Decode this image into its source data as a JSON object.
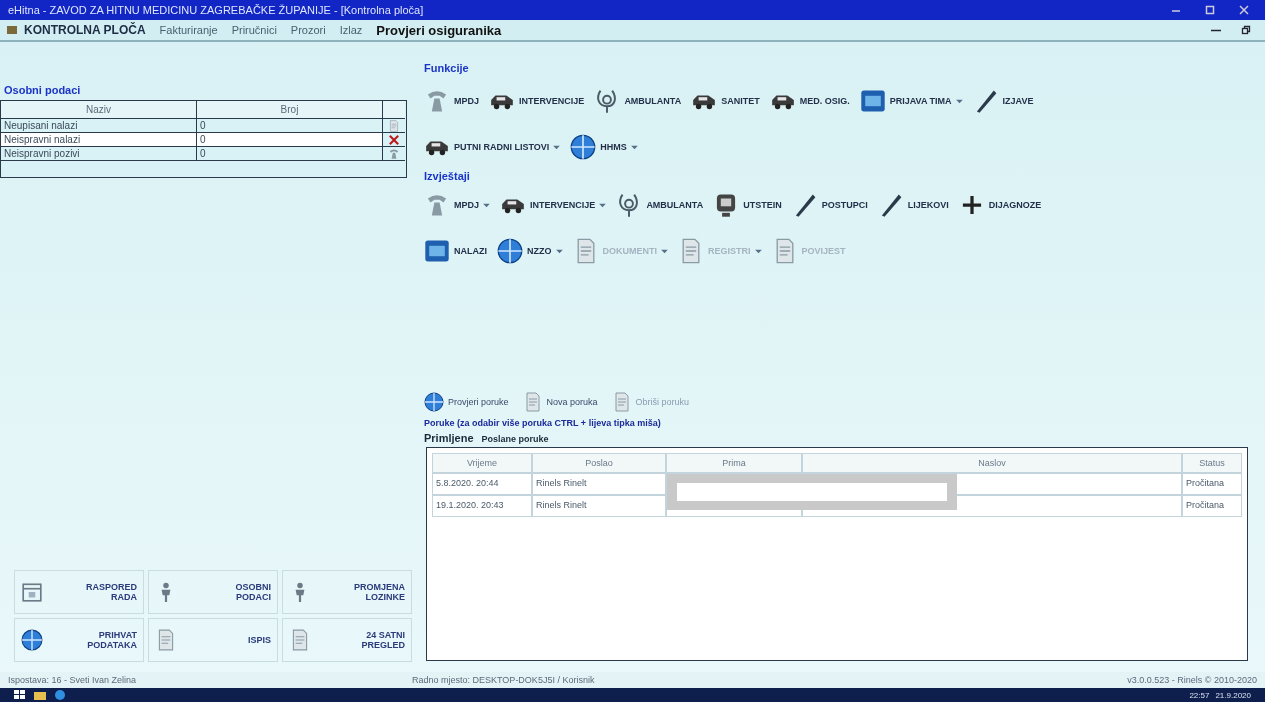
{
  "window": {
    "title": "eHitna - ZAVOD ZA HITNU MEDICINU ZAGREBAČKE ŽUPANIJE - [Kontrolna ploča]"
  },
  "menu": {
    "home": "KONTROLNA PLOČA",
    "items": [
      "Fakturiranje",
      "Priručnici",
      "Prozori",
      "Izlaz"
    ],
    "check": "Provjeri osiguranika"
  },
  "personal": {
    "title": "Osobni podaci",
    "columns": [
      "Naziv",
      "Broj"
    ],
    "rows": [
      {
        "name": "Neupisani nalazi",
        "count": "0",
        "selected": false,
        "kind": "doc"
      },
      {
        "name": "Neispravni nalazi",
        "count": "0",
        "selected": true,
        "kind": "cross"
      },
      {
        "name": "Neispravni pozivi",
        "count": "0",
        "selected": false,
        "kind": "phone"
      }
    ]
  },
  "functions": {
    "title": "Funkcije",
    "rows": [
      [
        {
          "label": "MPDJ",
          "kind": "phone",
          "menu": false,
          "disabled": false
        },
        {
          "label": "INTERVENCIJE",
          "kind": "vehicle",
          "menu": false,
          "disabled": false
        },
        {
          "label": "AMBULANTA",
          "kind": "stethoscope",
          "menu": false,
          "disabled": false
        },
        {
          "label": "SANITET",
          "kind": "vehicle",
          "menu": false,
          "disabled": false
        },
        {
          "label": "MED. OSIG.",
          "kind": "vehicle",
          "menu": false,
          "disabled": false
        },
        {
          "label": "PRIJAVA TIMA",
          "kind": "square",
          "menu": true,
          "disabled": false
        },
        {
          "label": "IZJAVE",
          "kind": "pen",
          "menu": false,
          "disabled": false
        }
      ],
      [
        {
          "label": "PUTNI RADNI LISTOVI",
          "kind": "vehicle",
          "menu": true,
          "disabled": false
        },
        {
          "label": "HHMS",
          "kind": "globe",
          "menu": true,
          "disabled": false
        }
      ]
    ]
  },
  "reports": {
    "title": "Izvještaji",
    "rows": [
      [
        {
          "label": "MPDJ",
          "kind": "phone",
          "menu": true,
          "disabled": false
        },
        {
          "label": "INTERVENCIJE",
          "kind": "vehicle",
          "menu": true,
          "disabled": false
        },
        {
          "label": "AMBULANTA",
          "kind": "stethoscope",
          "menu": false,
          "disabled": false
        },
        {
          "label": "UTSTEIN",
          "kind": "monitor",
          "menu": false,
          "disabled": false
        },
        {
          "label": "POSTUPCI",
          "kind": "pen",
          "menu": false,
          "disabled": false
        },
        {
          "label": "LIJEKOVI",
          "kind": "pen",
          "menu": false,
          "disabled": false
        },
        {
          "label": "DIJAGNOZE",
          "kind": "plus",
          "menu": false,
          "disabled": false
        }
      ],
      [
        {
          "label": "NALAZI",
          "kind": "square",
          "menu": false,
          "disabled": false
        },
        {
          "label": "NZZO",
          "kind": "globe",
          "menu": true,
          "disabled": false
        },
        {
          "label": "DOKUMENTI",
          "kind": "doc",
          "menu": true,
          "disabled": true
        },
        {
          "label": "REGISTRI",
          "kind": "doc",
          "menu": true,
          "disabled": true
        },
        {
          "label": "POVIJEST",
          "kind": "doc",
          "menu": false,
          "disabled": true
        }
      ]
    ]
  },
  "messages": {
    "actions": [
      {
        "label": "Provjeri poruke",
        "disabled": false
      },
      {
        "label": "Nova poruka",
        "disabled": false
      },
      {
        "label": "Obriši poruku",
        "disabled": true
      }
    ],
    "title": "Poruke (za odabir više poruka CTRL + lijeva tipka miša)",
    "tabs": [
      {
        "label": "Primljene",
        "selected": true
      },
      {
        "label": "Poslane poruke",
        "selected": false
      }
    ],
    "columns": [
      "Vrijeme",
      "Poslao",
      "Prima",
      "Naslov",
      "Status"
    ],
    "rows": [
      {
        "time": "5.8.2020. 20:44",
        "sender": "Rinels Rinelt",
        "status": "Pročitana"
      },
      {
        "time": "19.1.2020. 20:43",
        "sender": "Rinels Rinelt",
        "status": "Pročitana"
      }
    ]
  },
  "shortcuts": [
    {
      "label": "RASPORED RADA",
      "kind": "calendar"
    },
    {
      "label": "OSOBNI PODACI",
      "kind": "person"
    },
    {
      "label": "PROMJENA LOZINKE",
      "kind": "person"
    },
    {
      "label": "PRIHVAT PODATAKA",
      "kind": "globe"
    },
    {
      "label": "ISPIS",
      "kind": "doc"
    },
    {
      "label": "24 SATNI PREGLED",
      "kind": "doc"
    }
  ],
  "status_bar": {
    "branch": "Ispostava: 16 - Sveti Ivan Zelina",
    "workstation": "Radno mjesto: DESKTOP-DOK5J5I / Korisnik",
    "version": "v3.0.0.523 - Rinels © 2010-2020"
  },
  "taskbar": {
    "time": "22:57",
    "date": "21.9.2020"
  }
}
